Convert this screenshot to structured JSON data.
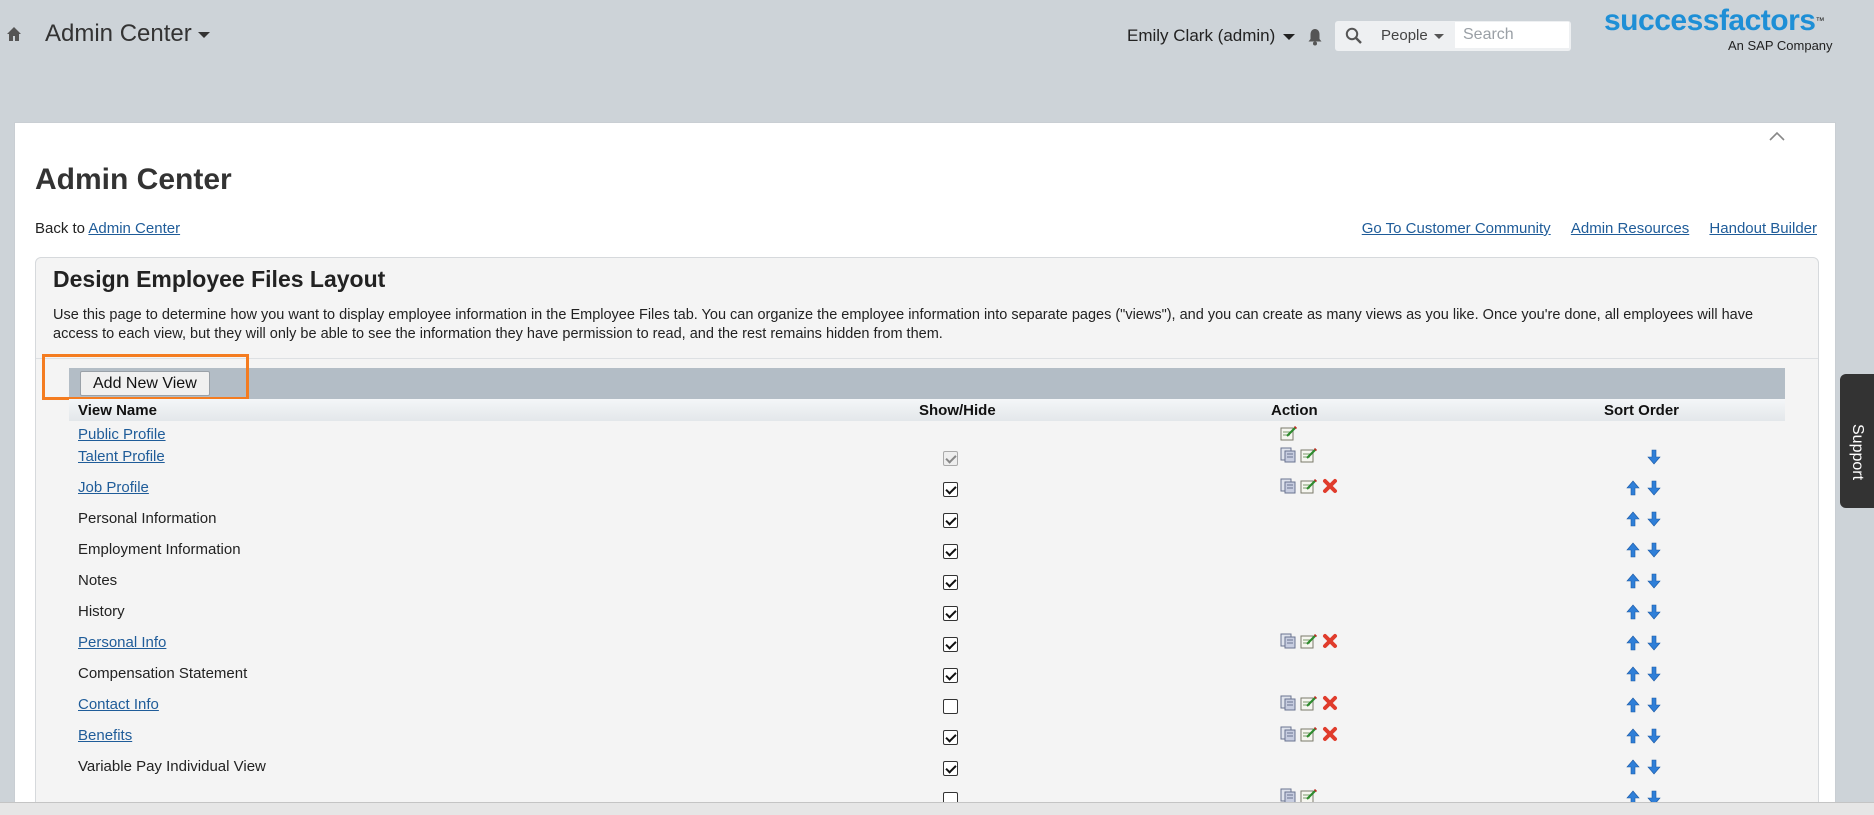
{
  "header": {
    "app_title": "Admin Center",
    "user_label": "Emily Clark (admin)",
    "search_scope": "People",
    "search_placeholder": "Search",
    "logo_text_a": "success",
    "logo_text_b": "factors",
    "logo_tm": "™",
    "logo_sub": "An SAP Company",
    "icons": [
      "home-icon",
      "bell-icon",
      "search-icon"
    ]
  },
  "page": {
    "title": "Admin Center",
    "back_prefix": "Back to",
    "back_link": "Admin Center",
    "links": [
      "Go To Customer Community",
      "Admin Resources",
      "Handout Builder"
    ]
  },
  "section": {
    "title": "Design Employee Files Layout",
    "description": "Use this page to determine how you want to display employee information in the Employee Files tab. You can organize the employee information into separate pages (\"views\"), and you can create as many views as you like. Once you're done, all employees will have access to each view, but they will only be able to see the information they have permission to read, and the rest remains hidden from them.",
    "add_button": "Add New View"
  },
  "table": {
    "columns": [
      "View Name",
      "Show/Hide",
      "Action",
      "Sort Order"
    ],
    "rows": [
      {
        "name": "Public Profile",
        "link": true,
        "show": null,
        "actions": [
          "edit"
        ],
        "sort": []
      },
      {
        "name": "Talent Profile",
        "link": true,
        "show": "disabled",
        "actions": [
          "copy",
          "edit"
        ],
        "sort": [
          "down"
        ]
      },
      {
        "name": "Job Profile",
        "link": true,
        "show": true,
        "actions": [
          "copy",
          "edit",
          "delete"
        ],
        "sort": [
          "up",
          "down"
        ]
      },
      {
        "name": "Personal Information",
        "link": false,
        "show": true,
        "actions": [],
        "sort": [
          "up",
          "down"
        ]
      },
      {
        "name": "Employment Information",
        "link": false,
        "show": true,
        "actions": [],
        "sort": [
          "up",
          "down"
        ]
      },
      {
        "name": "Notes",
        "link": false,
        "show": true,
        "actions": [],
        "sort": [
          "up",
          "down"
        ]
      },
      {
        "name": "History",
        "link": false,
        "show": true,
        "actions": [],
        "sort": [
          "up",
          "down"
        ]
      },
      {
        "name": "Personal Info",
        "link": true,
        "show": true,
        "actions": [
          "copy",
          "edit",
          "delete"
        ],
        "sort": [
          "up",
          "down"
        ]
      },
      {
        "name": "Compensation Statement",
        "link": false,
        "show": true,
        "actions": [],
        "sort": [
          "up",
          "down"
        ]
      },
      {
        "name": "Contact Info",
        "link": true,
        "show": false,
        "actions": [
          "copy",
          "edit",
          "delete"
        ],
        "sort": [
          "up",
          "down"
        ]
      },
      {
        "name": "Benefits",
        "link": true,
        "show": true,
        "actions": [
          "copy",
          "edit",
          "delete"
        ],
        "sort": [
          "up",
          "down"
        ]
      },
      {
        "name": "Variable Pay Individual View",
        "link": false,
        "show": true,
        "actions": [],
        "sort": [
          "up",
          "down"
        ]
      },
      {
        "name": "",
        "link": false,
        "show": false,
        "actions": [
          "copy",
          "edit"
        ],
        "sort": [
          "up",
          "down"
        ]
      }
    ]
  },
  "support_tab": "Support",
  "colors": {
    "accent": "#1e8fd6",
    "highlight": "#f47c20",
    "link": "#1f5c99",
    "delete": "#e03c2c"
  }
}
